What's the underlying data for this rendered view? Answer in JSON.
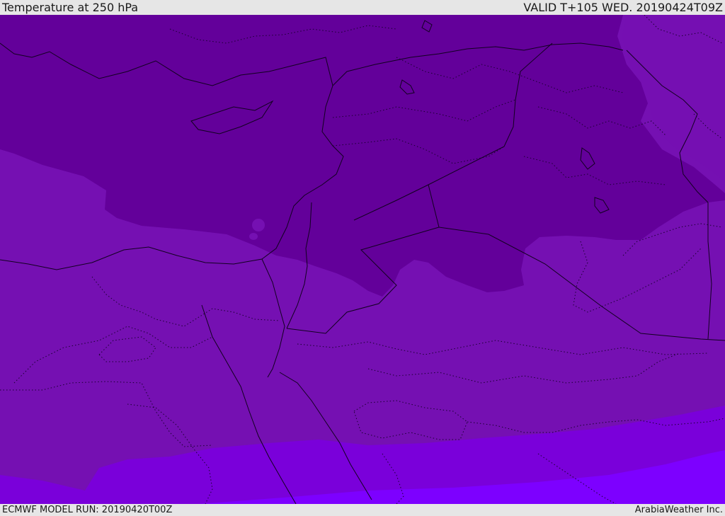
{
  "header": {
    "title": "Temperature at 250 hPa",
    "valid": "VALID T+105 WED. 20190424T09Z"
  },
  "footer": {
    "model_run": "ECMWF MODEL RUN: 20190420T00Z",
    "credit": "ArabiaWeather Inc."
  },
  "legend_colors": {
    "coldest": "#63009a",
    "cold": "#7510b2",
    "mid": "#7a00da",
    "warm": "#7d00ff"
  }
}
